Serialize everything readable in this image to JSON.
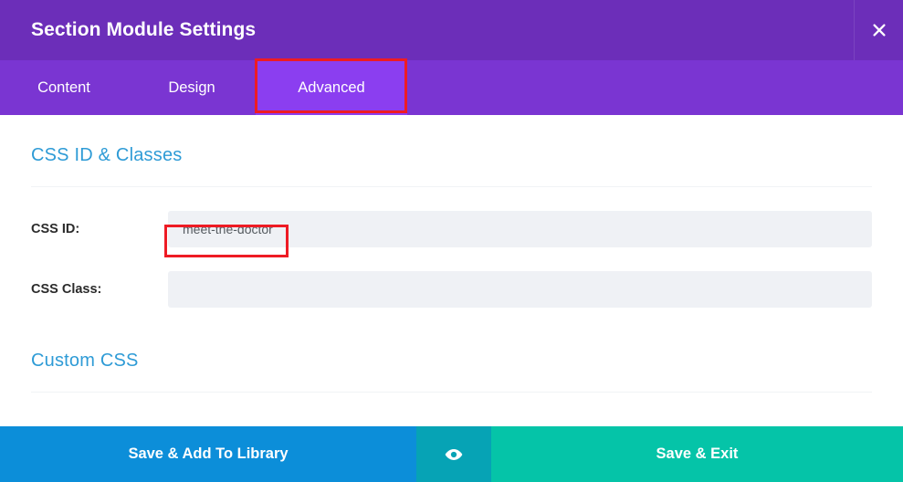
{
  "header": {
    "title": "Section Module Settings",
    "close_icon": "close-icon",
    "bg_color": "#6c2eb9"
  },
  "tabs": {
    "active": "Advanced",
    "items": [
      {
        "label": "Content",
        "name": "tab-content"
      },
      {
        "label": "Design",
        "name": "tab-design"
      },
      {
        "label": "Advanced",
        "name": "tab-advanced"
      }
    ],
    "bg_color": "#7a35d2",
    "active_bg_color": "#8b3ef0"
  },
  "body": {
    "section_one": {
      "heading": "CSS ID & Classes",
      "heading_color": "#2e9bd6",
      "fields": [
        {
          "label": "CSS ID:",
          "value": "meet-the-doctor",
          "placeholder": ""
        },
        {
          "label": "CSS Class:",
          "value": "",
          "placeholder": ""
        }
      ]
    },
    "section_two": {
      "heading": "Custom CSS",
      "heading_color": "#2e9bd6"
    }
  },
  "footer": {
    "save_add_library_label": "Save & Add To Library",
    "preview_icon": "eye-icon",
    "save_exit_label": "Save & Exit",
    "library_color": "#0c8ed9",
    "preview_color": "#06a3b5",
    "exit_color": "#05c4a8"
  },
  "annotations": {
    "color": "#ee1b24",
    "items": [
      {
        "target": "advanced-tab"
      },
      {
        "target": "css-id-input"
      }
    ]
  }
}
